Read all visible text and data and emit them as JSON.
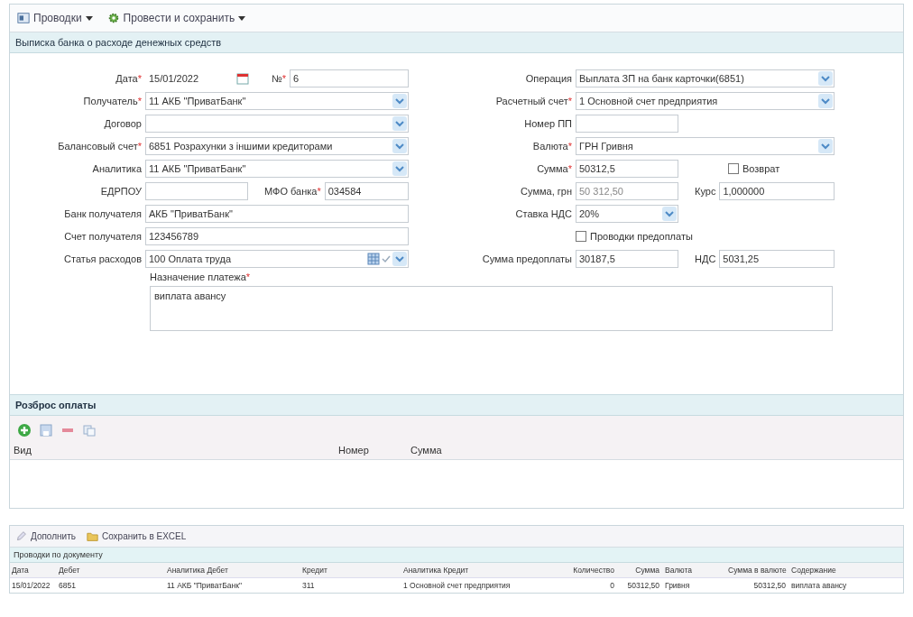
{
  "toolbar": [
    {
      "label": "Проводки"
    },
    {
      "label": "Провести и сохранить"
    }
  ],
  "panel_title": "Выписка банка о расходе денежных средств",
  "left_rows": [
    [
      {
        "kind": "date",
        "label": "Дата",
        "required_mark": "*",
        "value": "15/01/2022"
      },
      {
        "kind": "text",
        "label": "№",
        "required_mark": "*",
        "value": "6"
      }
    ],
    [
      {
        "kind": "combo",
        "label": "Получатель",
        "required_mark": "*",
        "value": "11 АКБ \"ПриватБанк\""
      }
    ],
    [
      {
        "kind": "combo",
        "label": "Договор"
      }
    ],
    [
      {
        "kind": "combo",
        "label": "Балансовый счет",
        "required_mark": "*",
        "value": "6851 Розрахунки з іншими кредиторами"
      }
    ],
    [
      {
        "kind": "combo",
        "label": "Аналитика",
        "value": "11 АКБ \"ПриватБанк\""
      }
    ],
    [
      {
        "kind": "text-short",
        "label": "ЕДРПОУ"
      },
      {
        "kind": "text",
        "label": "МФО банка",
        "required_mark": "*",
        "value": "034584"
      }
    ],
    [
      {
        "kind": "text",
        "label": "Банк получателя",
        "value": "АКБ \"ПриватБанк\""
      }
    ],
    [
      {
        "kind": "text",
        "label": "Счет получателя",
        "value": "123456789"
      }
    ],
    [
      {
        "kind": "lookup",
        "label": "Статья расходов",
        "value": "100 Оплата труда"
      }
    ]
  ],
  "right_rows": [
    [
      {
        "kind": "combo",
        "label": "Операция",
        "value": "Выплата ЗП на банк карточки(6851)"
      }
    ],
    [
      {
        "kind": "combo",
        "label": "Расчетный счет",
        "required_mark": "*",
        "value": "1 Основной счет предприятия"
      }
    ],
    [
      {
        "kind": "text-short",
        "label": "Номер ПП"
      }
    ],
    [
      {
        "kind": "combo",
        "label": "Валюта",
        "required_mark": "*",
        "value": "ГРН Гривня"
      }
    ],
    [
      {
        "kind": "text-short",
        "label": "Сумма",
        "required_mark": "*",
        "value": "50312,5"
      },
      {
        "kind": "checkbox",
        "label": "Возврат",
        "checked": false
      }
    ],
    [
      {
        "kind": "text-short",
        "label": "Сумма, грн",
        "readonly": true,
        "value": "50 312,50"
      },
      {
        "kind": "text",
        "label": "Курс",
        "value": "1,000000"
      }
    ],
    [
      {
        "kind": "combo-short",
        "label": "Ставка НДС",
        "value": "20%"
      }
    ],
    [
      {
        "kind": "checkbox",
        "label": "Проводки предоплаты",
        "checked": false
      }
    ],
    [
      {
        "kind": "text-short",
        "label": "Сумма предоплаты",
        "value": "30187,5"
      },
      {
        "kind": "text",
        "label": "НДС",
        "value": "5031,25"
      }
    ]
  ],
  "purpose": {
    "label": "Назначение платежа",
    "required_mark": "*",
    "value": "виплата  авансу"
  },
  "spread": {
    "title": "Розброс оплаты",
    "columns": [
      "Вид",
      "Номер",
      "Сумма"
    ]
  },
  "bottom_toolbar": [
    {
      "label": "Дополнить"
    },
    {
      "label": "Сохранить в EXCEL"
    }
  ],
  "entries": {
    "title": "Проводки по документу",
    "columns": [
      "Дата",
      "Дебет",
      "Аналитика Дебет",
      "Кредит",
      "Аналитика Кредит",
      "Количество",
      "Сумма",
      "Валюта",
      "Сумма в валюте",
      "Содержание"
    ],
    "rows": [
      [
        "15/01/2022",
        "6851",
        "11 АКБ \"ПриватБанк\"",
        "311",
        "1 Основной счет предприятия",
        "0",
        "50312,50",
        "Гривня",
        "50312,50",
        "виплата авансу"
      ]
    ]
  }
}
